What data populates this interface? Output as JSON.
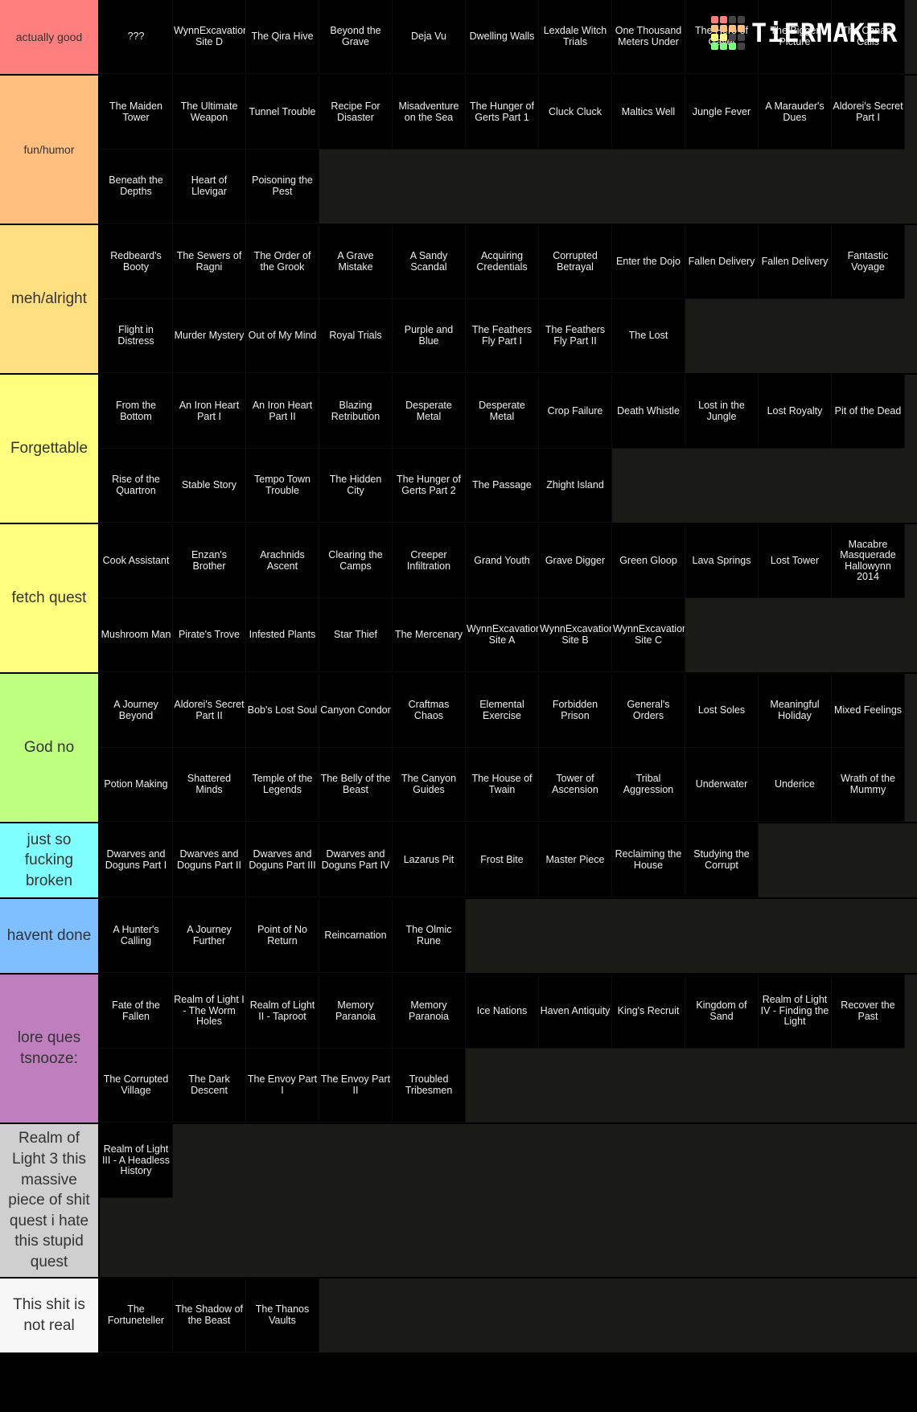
{
  "logo": {
    "text": "TiERMAKER",
    "grid_colors": [
      "#ff7f7f",
      "#ff7f7f",
      "#444",
      "#444",
      "#ffbf7f",
      "#ffbf7f",
      "#ffbf7f",
      "#ffbf7f",
      "#ffff7f",
      "#ffff7f",
      "#444",
      "#444",
      "#7fff7f",
      "#7fff7f",
      "#7fff7f",
      "#444"
    ]
  },
  "tiers": [
    {
      "label": "actually good",
      "color": "#ff7f7f",
      "small": true,
      "items": [
        "???",
        "WynnExcavation Site D",
        "The Qira Hive",
        "Beyond the Grave",
        "Deja Vu",
        "Dwelling Walls",
        "Lexdale Witch Trials",
        "One Thousand Meters Under",
        "The Hero of Gavel",
        "The Bigger Picture",
        "The Canary Calls"
      ]
    },
    {
      "label": "fun/humor",
      "color": "#ffbf7f",
      "small": true,
      "items": [
        "The Maiden Tower",
        "The Ultimate Weapon",
        "Tunnel Trouble",
        "Recipe For Disaster",
        "Misadventure on the Sea",
        "The Hunger of Gerts Part 1",
        "Cluck Cluck",
        "Maltics Well",
        "Jungle Fever",
        "A Marauder's Dues",
        "Aldorei's Secret Part I",
        "Beneath the Depths",
        "Heart of Llevigar",
        "Poisoning the Pest"
      ]
    },
    {
      "label": "meh/alright",
      "color": "#ffdf7f",
      "items": [
        "Redbeard's Booty",
        "The Sewers of Ragni",
        "The Order of the Grook",
        "A Grave Mistake",
        "A Sandy Scandal",
        "Acquiring Credentials",
        "Corrupted Betrayal",
        "Enter the Dojo",
        "Fallen Delivery",
        "Fallen Delivery",
        "Fantastic Voyage",
        "Flight in Distress",
        "Murder Mystery",
        "Out of My Mind",
        "Royal Trials",
        "Purple and Blue",
        "The Feathers Fly Part I",
        "The Feathers Fly Part II",
        "The Lost"
      ]
    },
    {
      "label": "Forgettable",
      "color": "#ffff7f",
      "items": [
        "From the Bottom",
        "An Iron Heart Part I",
        "An Iron Heart Part II",
        "Blazing Retribution",
        "Desperate Metal",
        "Desperate Metal",
        "Crop Failure",
        "Death Whistle",
        "Lost in the Jungle",
        "Lost Royalty",
        "Pit of the Dead",
        "Rise of the Quartron",
        "Stable Story",
        "Tempo Town Trouble",
        "The Hidden City",
        "The Hunger of Gerts Part 2",
        "The Passage",
        "Zhight Island"
      ]
    },
    {
      "label": "fetch quest",
      "color": "#ffff7f",
      "items": [
        "Cook Assistant",
        "Enzan's Brother",
        "Arachnids Ascent",
        "Clearing the Camps",
        "Creeper Infiltration",
        "Grand Youth",
        "Grave Digger",
        "Green Gloop",
        "Lava Springs",
        "Lost Tower",
        "Macabre Masquerade Hallowynn 2014",
        "Mushroom Man",
        "Pirate's Trove",
        "Infested Plants",
        "Star Thief",
        "The Mercenary",
        "WynnExcavation Site A",
        "WynnExcavation Site B",
        "WynnExcavation Site C"
      ]
    },
    {
      "label": "God no",
      "color": "#bfff7f",
      "items": [
        "A Journey Beyond",
        "Aldorei's Secret Part II",
        "Bob's Lost Soul",
        "Canyon Condor",
        "Craftmas Chaos",
        "Elemental Exercise",
        "Forbidden Prison",
        "General's Orders",
        "Lost Soles",
        "Meaningful Holiday",
        "Mixed Feelings",
        "Potion Making",
        "Shattered Minds",
        "Temple of the Legends",
        "The Belly of the Beast",
        "The Canyon Guides",
        "The House of Twain",
        "Tower of Ascension",
        "Tribal Aggression",
        "Underwater",
        "Underice",
        "Wrath of the Mummy"
      ]
    },
    {
      "label": "just so fucking broken",
      "color": "#7fffff",
      "items": [
        "Dwarves and Doguns Part I",
        "Dwarves and Doguns Part II",
        "Dwarves and Doguns Part III",
        "Dwarves and Doguns Part IV",
        "Lazarus Pit",
        "Frost Bite",
        "Master Piece",
        "Reclaiming the House",
        "Studying the Corrupt"
      ]
    },
    {
      "label": "havent done",
      "color": "#7fbfff",
      "items": [
        "A Hunter's Calling",
        "A Journey Further",
        "Point of No Return",
        "Reincarnation",
        "The Olmic Rune"
      ]
    },
    {
      "label": "lore ques tsnooze:",
      "color": "#bf7fbf",
      "items": [
        "Fate of the Fallen",
        "Realm of Light I - The Worm Holes",
        "Realm of Light II - Taproot",
        "Memory Paranoia",
        "Memory Paranoia",
        "Ice Nations",
        "Haven Antiquity",
        "King's Recruit",
        "Kingdom of Sand",
        "Realm of Light IV - Finding the Light",
        "Recover the Past",
        "The Corrupted Village",
        "The Dark Descent",
        "The Envoy Part I",
        "The Envoy Part II",
        "Troubled Tribesmen"
      ]
    },
    {
      "label": "Realm of Light 3 this massive piece of shit quest i hate this stupid quest",
      "color": "#cfcfcf",
      "tall": true,
      "items": [
        "Realm of Light III - A Headless History"
      ]
    },
    {
      "label": "This shit is not real",
      "color": "#f7f7f7",
      "items": [
        "The Fortuneteller",
        "The Shadow of the Beast",
        "The Thanos Vaults"
      ]
    }
  ]
}
